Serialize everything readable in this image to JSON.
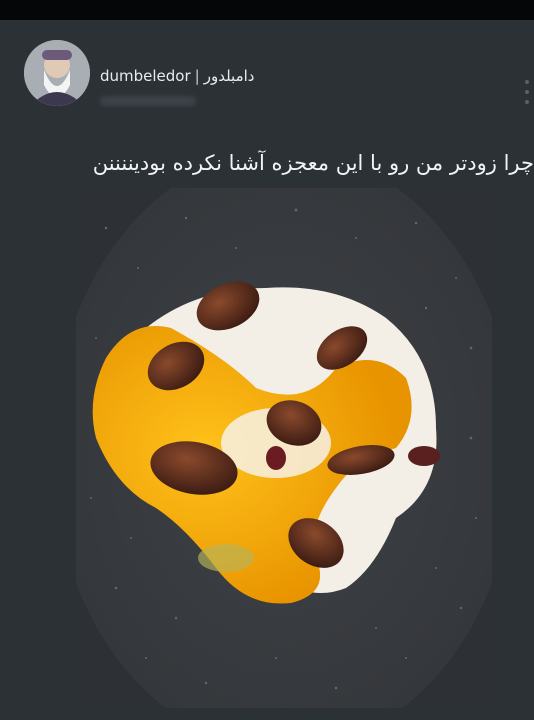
{
  "post": {
    "author_name": "dumbeledor",
    "author_persian": "دامبلدور",
    "separator": "|",
    "caption": "چرا زودتر من رو با این معجزه آشنا نکرده بودیننننن"
  },
  "icons": {
    "more": "more-vertical-icon"
  },
  "colors": {
    "background": "#2c3136",
    "text": "#f1f3f5",
    "egg_yolk": "#f2a800",
    "pan": "#3a3c3f"
  }
}
